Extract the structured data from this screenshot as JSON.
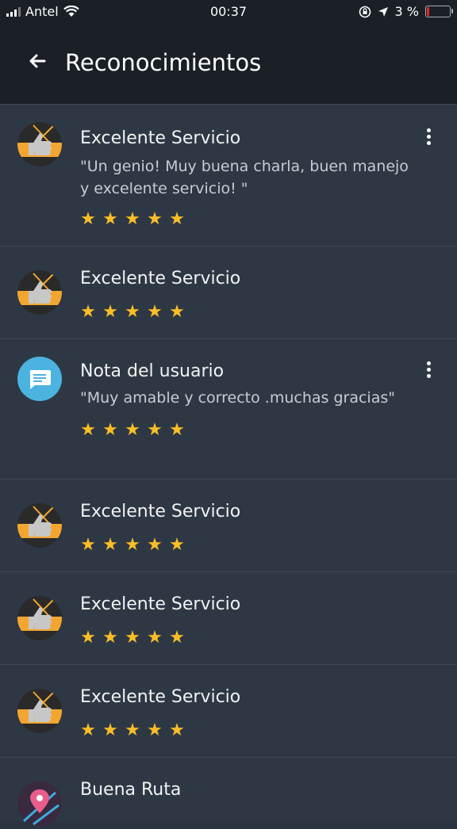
{
  "status_bar": {
    "carrier": "Antel",
    "time": "00:37",
    "battery": "3 %"
  },
  "app_bar": {
    "title": "Reconocimientos"
  },
  "colors": {
    "star": "#f9be27",
    "note_badge": "#4cb3e0",
    "background": "#2b3542",
    "header": "#1b2027"
  },
  "items": [
    {
      "icon": "thumbs-up-icon",
      "title": "Excelente Servicio",
      "comment": "\"Un genio! Muy buena charla, buen manejo y excelente servicio! \"",
      "rating": 5,
      "has_menu": true
    },
    {
      "icon": "thumbs-up-icon",
      "title": "Excelente Servicio",
      "comment": "",
      "rating": 5,
      "has_menu": false
    },
    {
      "icon": "chat-bubble-icon",
      "title": "Nota del usuario",
      "comment": "\"Muy amable y correcto .muchas gracias\"",
      "rating": 5,
      "has_menu": true
    },
    {
      "icon": "thumbs-up-icon",
      "title": "Excelente Servicio",
      "comment": "",
      "rating": 5,
      "has_menu": false
    },
    {
      "icon": "thumbs-up-icon",
      "title": "Excelente Servicio",
      "comment": "",
      "rating": 5,
      "has_menu": false
    },
    {
      "icon": "thumbs-up-icon",
      "title": "Excelente Servicio",
      "comment": "",
      "rating": 5,
      "has_menu": false
    },
    {
      "icon": "map-pin-icon",
      "title": "Buena Ruta",
      "comment": "",
      "rating": 0,
      "has_menu": false
    }
  ]
}
